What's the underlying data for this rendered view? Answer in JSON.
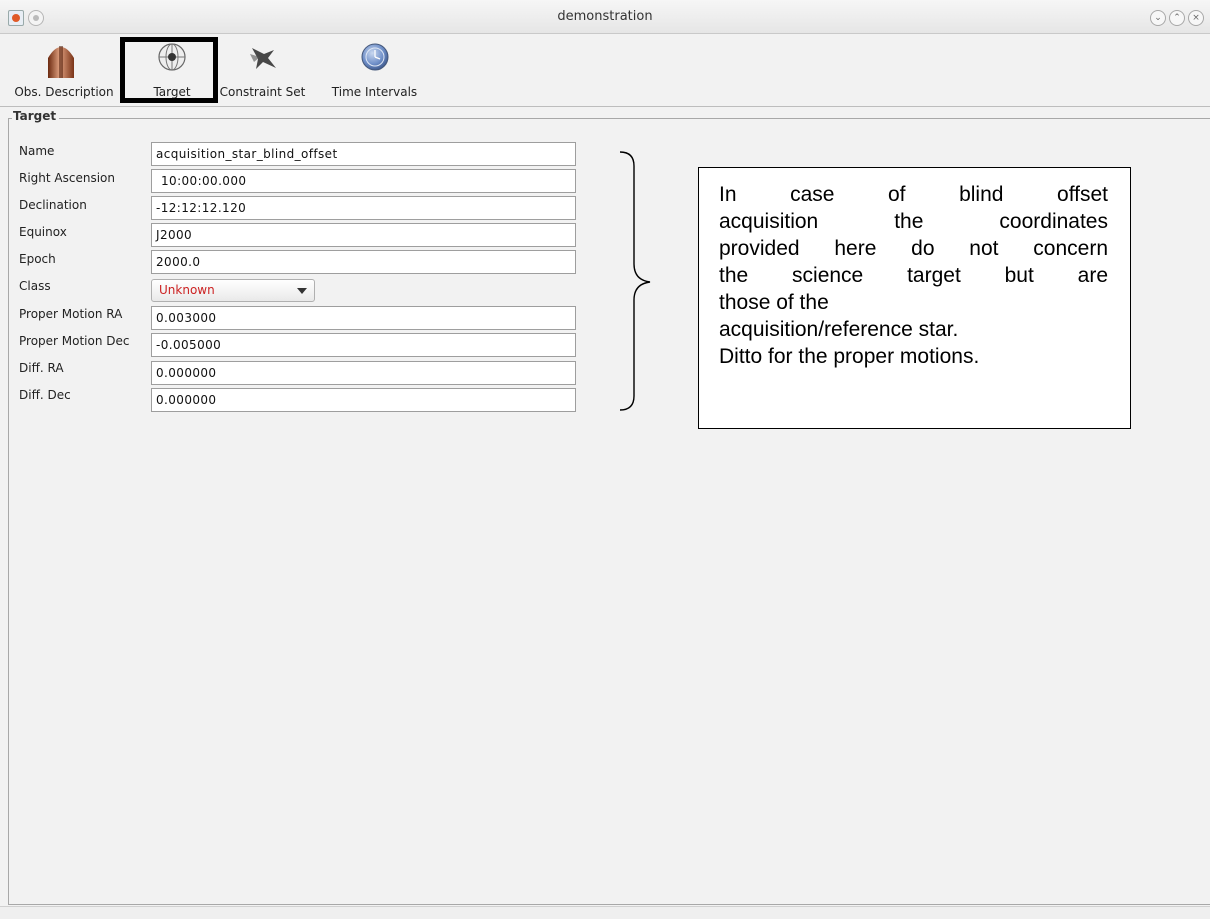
{
  "window": {
    "title": "demonstration",
    "controls": [
      "minimize-icon",
      "maximize-icon",
      "close-icon"
    ]
  },
  "toolbar": {
    "items": [
      {
        "label": "Obs. Description",
        "icon": "telescope-icon"
      },
      {
        "label": "Target",
        "icon": "globe-icon",
        "selected": true
      },
      {
        "label": "Constraint Set",
        "icon": "star-icon"
      },
      {
        "label": "Time Intervals",
        "icon": "clock-icon"
      }
    ]
  },
  "panel": {
    "title": "Target",
    "fields": [
      {
        "label": "Name",
        "value": "acquisition_star_blind_offset"
      },
      {
        "label": "Right Ascension",
        "value": "10:00:00.000"
      },
      {
        "label": "Declination",
        "value": "-12:12:12.120"
      },
      {
        "label": "Equinox",
        "value": "J2000"
      },
      {
        "label": "Epoch",
        "value": "2000.0"
      },
      {
        "label": "Class",
        "value": "Unknown"
      },
      {
        "label": "Proper Motion RA",
        "value": "0.003000"
      },
      {
        "label": "Proper Motion Dec",
        "value": "-0.005000"
      },
      {
        "label": "Diff. RA",
        "value": "0.000000"
      },
      {
        "label": "Diff. Dec",
        "value": "0.000000"
      }
    ]
  },
  "callout": {
    "lines": [
      "In case of blind offset",
      "acquisition the coordinates",
      "provided here do not concern",
      "the science target but are",
      "those of the",
      "acquisition/reference star.",
      "Ditto for the proper motions."
    ]
  },
  "colors": {
    "class_value": "#cc2222",
    "highlight_box": "#000000"
  }
}
